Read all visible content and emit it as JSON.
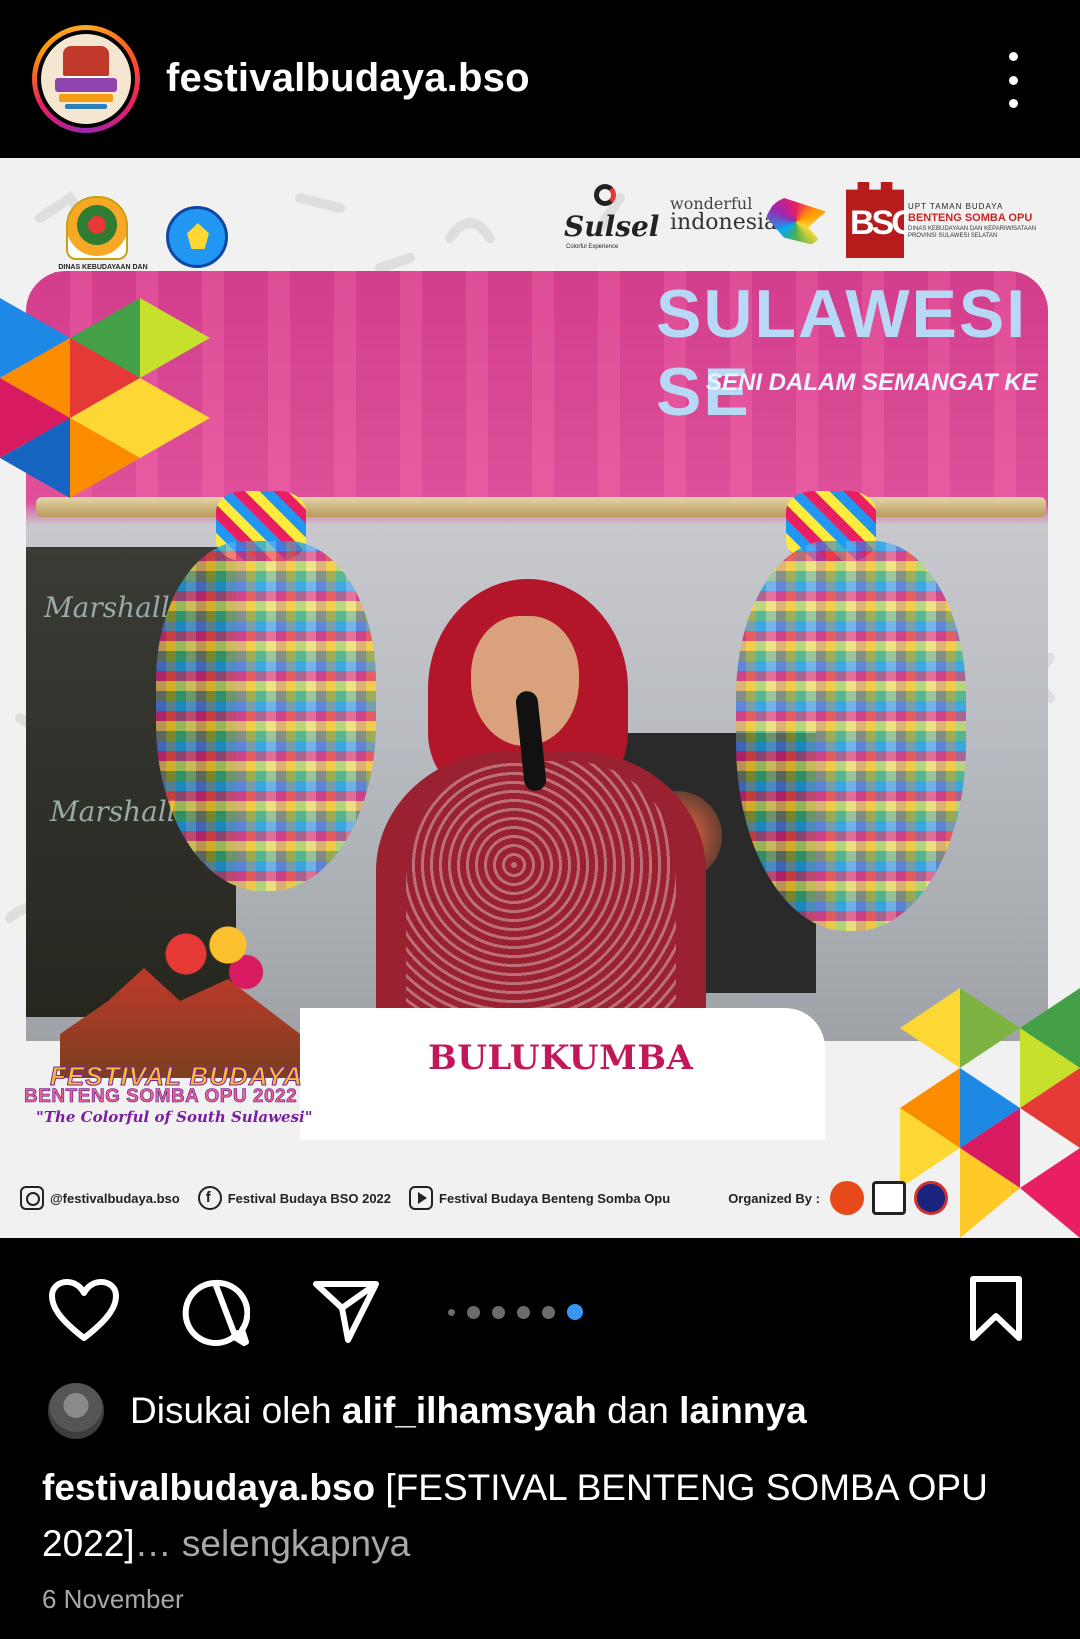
{
  "header": {
    "username": "festivalbudaya.bso",
    "more_icon": "more-vertical-icon"
  },
  "post": {
    "logos": {
      "gov_caption": "DINAS KEBUDAYAAN DAN KEPARIWISATAAN PROVINSI SULAWESI SELATAN",
      "sulsel": "Sulsel",
      "sulsel_sub": "Colorful Experience",
      "wonderful_top": "wonderful",
      "wonderful_bottom": "indonesia",
      "bso_mark": "BSO",
      "bso_line1": "UPT TAMAN BUDAYA",
      "bso_line2": "BENTENG SOMBA OPU",
      "bso_line3": "DINAS KEBUDAYAAN DAN KEPARIWISATAAN PROVINSI SULAWESI SELATAN"
    },
    "screen_title": "SULAWESI SE",
    "screen_subtitle": "SENI DALAM SEMANGAT KE",
    "amp_brand": "Marshall",
    "region": "BULUKUMBA",
    "festival": {
      "line1": "FESTIVAL BUDAYA",
      "line2": "BENTENG SOMBA OPU 2022",
      "line3": "\"The Colorful of South Sulawesi\""
    },
    "footer": {
      "instagram": "@festivalbudaya.bso",
      "facebook": "Festival Budaya BSO 2022",
      "youtube": "Festival Budaya Benteng Somba Opu",
      "organized": "Organized By :"
    }
  },
  "actions": {
    "like_icon": "heart-icon",
    "comment_icon": "comment-icon",
    "share_icon": "send-icon",
    "save_icon": "bookmark-icon",
    "carousel_total": 6,
    "carousel_active": 6,
    "active_color": "#3897f0"
  },
  "meta": {
    "liked_prefix": "Disukai oleh ",
    "liked_user": "alif_ilhamsyah",
    "liked_middle": " dan ",
    "liked_suffix": "lainnya",
    "caption_user": "festivalbudaya.bso",
    "caption_text": " [FESTIVAL BENTENG SOMBA OPU 2022]",
    "caption_more": "… selengkapnya",
    "date": "6 November"
  }
}
